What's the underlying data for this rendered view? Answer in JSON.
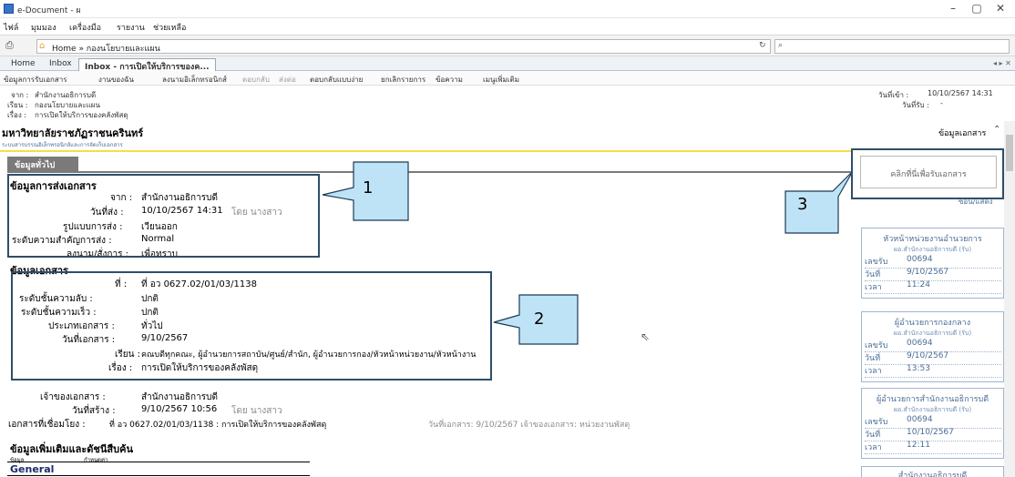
{
  "window": {
    "title": "e-Document - ผ",
    "minimize": "–",
    "restore": "▢",
    "close": "✕"
  },
  "menu": [
    "ไฟล์",
    "มุมมอง",
    "เครื่องมือ",
    "รายงาน",
    "ช่วยเหลือ"
  ],
  "address": {
    "breadcrumb": "Home » กองนโยบายและแผน"
  },
  "tabs": [
    "Home",
    "Inbox",
    "Inbox - การเปิดให้บริการของค..."
  ],
  "toolbar": {
    "items": [
      "ข้อมูลการรับเอกสาร",
      "งานของฉัน",
      "ลงนามอิเล็กทรอนิกส์",
      "ตอบกลับ",
      "ส่งต่อ",
      "ตอบกลับแบบง่าย",
      "ยกเลิกรายการ",
      "ข้อความ",
      "เมนูเพิ่มเติม"
    ]
  },
  "header": {
    "from_label": "จาก :",
    "from_value": "สำนักงานอธิการบดี",
    "to_label": "เรียน :",
    "to_value": "กองนโยบายและแผน",
    "subject_label": "เรื่อง :",
    "subject_value": "การเปิดให้บริการของคลังพัสดุ",
    "received_label": "วันที่เข้า :",
    "received_value": "10/10/2567 14:31",
    "accept_label": "วันที่รับ :",
    "accept_value": "-"
  },
  "university": {
    "name": "มหาวิทยาลัยราชภัฏราชนครินทร์",
    "subtitle": "ระบบสารบรรณอิเล็กทรอนิกส์และการจัดเก็บเอกสาร",
    "doc_info_link": "ข้อมูลเอกสาร"
  },
  "section_tab": "ข้อมูลทั่วไป",
  "sending": {
    "heading": "ข้อมูลการส่งเอกสาร",
    "rows": [
      {
        "label": "จาก :",
        "value": "สำนักงานอธิการบดี",
        "extra": ""
      },
      {
        "label": "วันที่ส่ง :",
        "value": "10/10/2567 14:31",
        "extra": "โดย นางสาว"
      },
      {
        "label": "รูปแบบการส่ง :",
        "value": "เวียนออก",
        "extra": ""
      },
      {
        "label": "ระดับความสำคัญการส่ง :",
        "value": "Normal",
        "extra": ""
      },
      {
        "label": "ลงนาม/สั่งการ :",
        "value": "เพื่อทราบ",
        "extra": ""
      }
    ]
  },
  "document": {
    "heading": "ข้อมูลเอกสาร",
    "rows": [
      {
        "label": "ที่ :",
        "value": "ที่ อว 0627.02/01/03/1138"
      },
      {
        "label": "ระดับชั้นความลับ :",
        "value": "ปกติ"
      },
      {
        "label": "ระดับชั้นความเร็ว :",
        "value": "ปกติ"
      },
      {
        "label": "ประเภทเอกสาร :",
        "value": "ทั่วไป"
      },
      {
        "label": "วันที่เอกสาร :",
        "value": "9/10/2567"
      },
      {
        "label": "เรียน :",
        "value": "คณบดีทุกคณะ, ผู้อำนวยการสถาบัน/ศูนย์/สำนัก, ผู้อำนวยการกอง/หัวหน้าหน่วยงาน/หัวหน้างาน"
      },
      {
        "label": "เรื่อง :",
        "value": "การเปิดให้บริการของคลังพัสดุ"
      }
    ]
  },
  "owner": {
    "owner_label": "เจ้าของเอกสาร :",
    "owner_value": "สำนักงานอธิการบดี",
    "created_label": "วันที่สร้าง :",
    "created_value": "9/10/2567 10:56",
    "created_by": "โดย นางสาว",
    "linked_label": "เอกสารที่เชื่อมโยง :",
    "linked_value": "ที่ อว 0627.02/01/03/1138 : การเปิดให้บริการของคลังพัสดุ",
    "linked_extra": "วันที่เอกสาร: 9/10/2567 เจ้าของเอกสาร: หน่วยงานพัสดุ"
  },
  "extra": {
    "heading": "ข้อมูลเพิ่มเติมและดัชนีสืบค้น",
    "col1": "ข้อมูล",
    "col2": "กำหนดค่า",
    "general": "General"
  },
  "callouts": [
    "1",
    "2",
    "3"
  ],
  "receive_button": "คลิกที่นี่เพื่อรับเอกสาร",
  "show_hide": "ซ่อน/แสดง",
  "cards": [
    {
      "title": "หัวหน้าหน่วยงานอำนวยการ",
      "sub": "ผอ.สำนักงานอธิการบดี (รับ)",
      "no_label": "เลขรับ",
      "no": "00694",
      "date_label": "วันที่",
      "date": "9/10/2567",
      "time_label": "เวลา",
      "time": "11:24"
    },
    {
      "title": "ผู้อำนวยการกองกลาง",
      "sub": "ผอ.สำนักงานอธิการบดี (รับ)",
      "no_label": "เลขรับ",
      "no": "00694",
      "date_label": "วันที่",
      "date": "9/10/2567",
      "time_label": "เวลา",
      "time": "13:53"
    },
    {
      "title": "ผู้อำนวยการสำนักงานอธิการบดี",
      "sub": "ผอ.สำนักงานอธิการบดี (รับ)",
      "no_label": "เลขรับ",
      "no": "00694",
      "date_label": "วันที่",
      "date": "10/10/2567",
      "time_label": "เวลา",
      "time": "12:11"
    }
  ],
  "last_card_title": "สำนักงานอธิการบดี"
}
